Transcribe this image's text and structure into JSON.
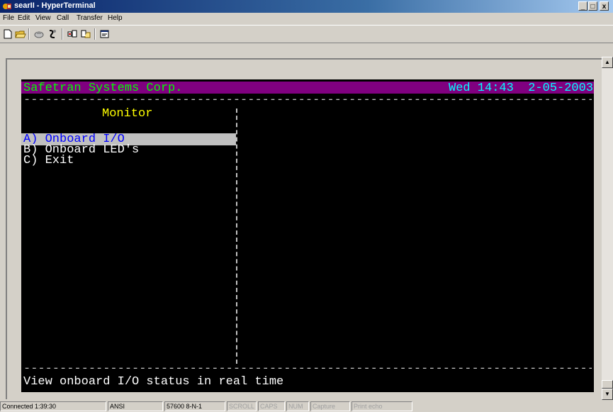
{
  "window": {
    "title": "searII - HyperTerminal",
    "app_icon": "hyperterminal-icon",
    "controls": {
      "minimize": "_",
      "maximize": "□",
      "close": "x"
    }
  },
  "menubar": {
    "items": [
      {
        "label": "File"
      },
      {
        "label": "Edit"
      },
      {
        "label": "View"
      },
      {
        "label": "Call"
      },
      {
        "label": "Transfer"
      },
      {
        "label": "Help"
      }
    ]
  },
  "toolbar": {
    "buttons": [
      "new-connection-icon",
      "open-folder-icon",
      "disconnect-icon",
      "call-icon",
      "send-icon",
      "receive-icon",
      "properties-icon"
    ]
  },
  "terminal": {
    "company": "Safetran Systems Corp.",
    "datetime": "Wed 14:43  2-05-2003",
    "dashes": "------------------------------------------------------------------------------------------",
    "menu_title": "Monitor",
    "items": [
      {
        "label": "A) Onboard I/O"
      },
      {
        "label": "B) Onboard LED's"
      },
      {
        "label": "C) Exit"
      }
    ],
    "status_line": "View onboard I/O status in real time",
    "colors": {
      "background": "#000000",
      "header_bar": "#800080",
      "company_text": "#00ff00",
      "datetime_text": "#00ffff",
      "title_text": "#ffff00",
      "menu_text": "#ffffff",
      "selected_text": "#0000ff",
      "selected_bg": "#c0c0c0"
    }
  },
  "statusbar": {
    "connected": "Connected 1:39:30",
    "emulation": "ANSI",
    "settings": "57600 8-N-1",
    "scroll": "SCROLL",
    "caps": "CAPS",
    "num": "NUM",
    "capture": "Capture",
    "print_echo": "Print echo"
  }
}
